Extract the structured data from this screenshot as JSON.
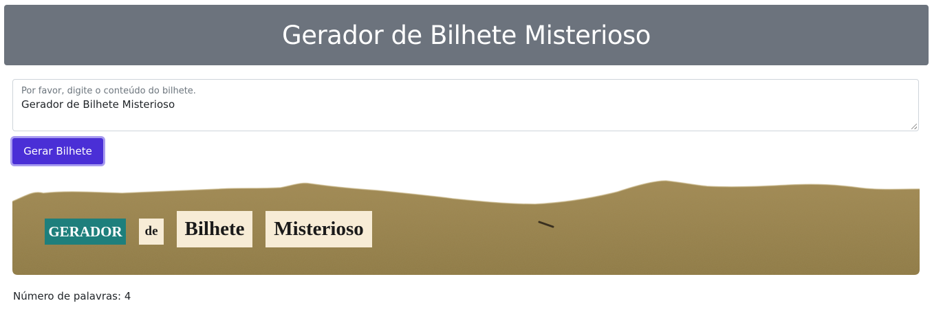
{
  "header": {
    "title": "Gerador de Bilhete Misterioso"
  },
  "form": {
    "label": "Por favor, digite o conteúdo do bilhete.",
    "value": "Gerador de Bilhete Misterioso",
    "button_label": "Gerar Bilhete"
  },
  "note": {
    "words": [
      "GERADOR",
      "de",
      "Bilhete",
      "Misterioso"
    ],
    "colors": {
      "paper": "#9c8550",
      "word_bg_teal": "#1e7f7c",
      "word_bg_cream": "#f7ecd6"
    }
  },
  "footer": {
    "word_count_label": "Número de palavras: 4"
  },
  "colors": {
    "header_bg": "#6c737d",
    "button_bg": "#4a2fd6",
    "button_ring": "#a89cf0"
  }
}
